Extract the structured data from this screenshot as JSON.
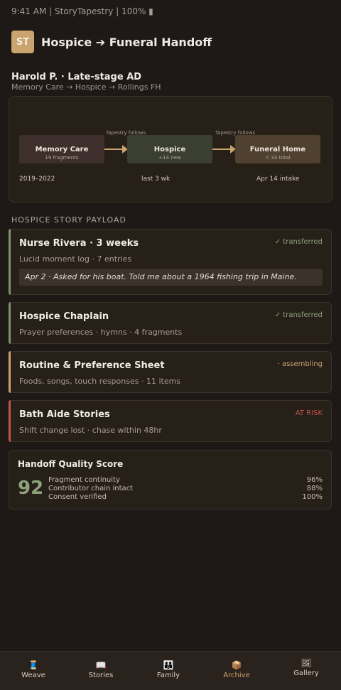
{
  "status": {
    "text": "9:41 AM | StoryTapestry | 100% ▮"
  },
  "header": {
    "logo": "ST",
    "title": "Hospice ➔ Funeral Handoff"
  },
  "patient": {
    "name": "Harold P. · Late-stage AD",
    "path": "Memory Care → Hospice → Rollings FH"
  },
  "flow": {
    "stages": [
      {
        "name": "Memory Care",
        "sub": "19 fragments",
        "period": "2019–2022"
      },
      {
        "name": "Hospice",
        "sub": "+14 new",
        "period": "last 3 wk"
      },
      {
        "name": "Funeral Home",
        "sub": "= 33 total",
        "period": "Apr 14 intake"
      }
    ],
    "connector_label": "Tapestry follows"
  },
  "section_title": "HOSPICE STORY PAYLOAD",
  "cards": [
    {
      "title": "Nurse Rivera · 3 weeks",
      "subtitle": "Lucid moment log · 7 entries",
      "badge": "✓ transferred",
      "quote": "Apr 2 · Asked for his boat. Told me about a 1964 fishing trip in Maine."
    },
    {
      "title": "Hospice Chaplain",
      "subtitle": "Prayer preferences · hymns · 4 fragments",
      "badge": "✓ transferred"
    },
    {
      "title": "Routine & Preference Sheet",
      "subtitle": "Foods, songs, touch responses · 11 items",
      "badge": "· assembling"
    },
    {
      "title": "Bath Aide Stories",
      "subtitle": "Shift change lost · chase within 48hr",
      "badge": "AT RISK"
    }
  ],
  "colors": {
    "transferred": "#8ea27a",
    "assembling": "#c9a46e",
    "at_risk": "#c2554b",
    "accent": "#c9a46e"
  },
  "score": {
    "title": "Handoff Quality Score",
    "value": "92",
    "metrics": [
      {
        "label": "Fragment continuity",
        "value": "96%"
      },
      {
        "label": "Contributor chain intact",
        "value": "88%"
      },
      {
        "label": "Consent verified",
        "value": "100%"
      }
    ]
  },
  "nav": [
    {
      "icon": "spool-icon",
      "glyph": "🧵",
      "label": "Weave"
    },
    {
      "icon": "book-icon",
      "glyph": "📖",
      "label": "Stories"
    },
    {
      "icon": "family-icon",
      "glyph": "👪",
      "label": "Family"
    },
    {
      "icon": "archive-box-icon",
      "glyph": "📦",
      "label": "Archive",
      "active": true
    },
    {
      "icon": "gallery-icon",
      "glyph": "🖼",
      "label": "Gallery"
    }
  ]
}
